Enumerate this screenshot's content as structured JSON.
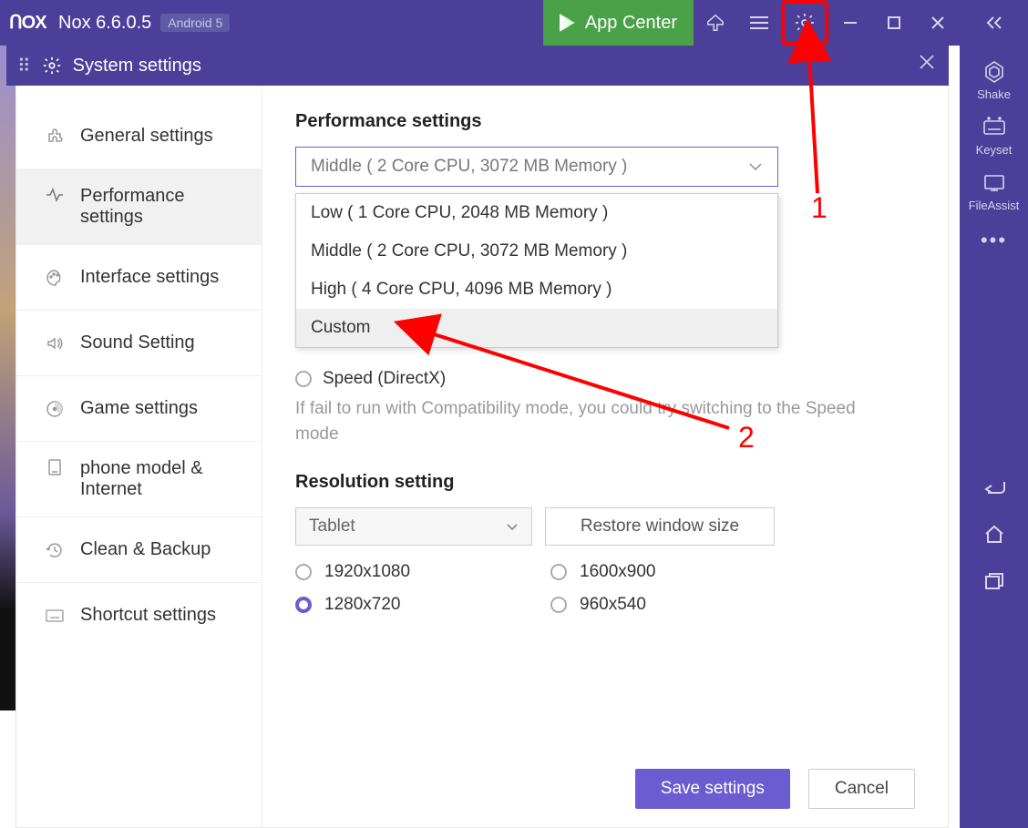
{
  "titlebar": {
    "app_name": "Nox 6.6.0.5",
    "android_badge": "Android 5",
    "app_center_label": "App Center"
  },
  "right_rail": {
    "items": [
      {
        "label": "Shake"
      },
      {
        "label": "Keyset"
      },
      {
        "label": "FileAssist"
      }
    ]
  },
  "settings_header": {
    "title": "System settings"
  },
  "sidebar": {
    "items": [
      {
        "label": "General settings"
      },
      {
        "label": "Performance settings"
      },
      {
        "label": "Interface settings"
      },
      {
        "label": "Sound Setting"
      },
      {
        "label": "Game settings"
      },
      {
        "label": "phone model & Internet"
      },
      {
        "label": "Clean & Backup"
      },
      {
        "label": "Shortcut settings"
      }
    ]
  },
  "perf": {
    "title": "Performance settings",
    "selected": "Middle ( 2 Core CPU, 3072 MB Memory )",
    "options": [
      "Low ( 1 Core CPU, 2048 MB Memory )",
      "Middle ( 2 Core CPU, 3072 MB Memory )",
      "High ( 4 Core CPU, 4096 MB Memory )",
      "Custom"
    ],
    "speed_label": "Speed (DirectX)",
    "speed_hint": "If fail to run with Compatibility mode, you could try switching to the Speed mode"
  },
  "resolution": {
    "title": "Resolution setting",
    "device": "Tablet",
    "restore": "Restore window size",
    "options": [
      "1920x1080",
      "1600x900",
      "1280x720",
      "960x540"
    ],
    "selected": "1280x720"
  },
  "footer": {
    "save": "Save settings",
    "cancel": "Cancel"
  },
  "annotation": {
    "one": "1",
    "two": "2"
  }
}
